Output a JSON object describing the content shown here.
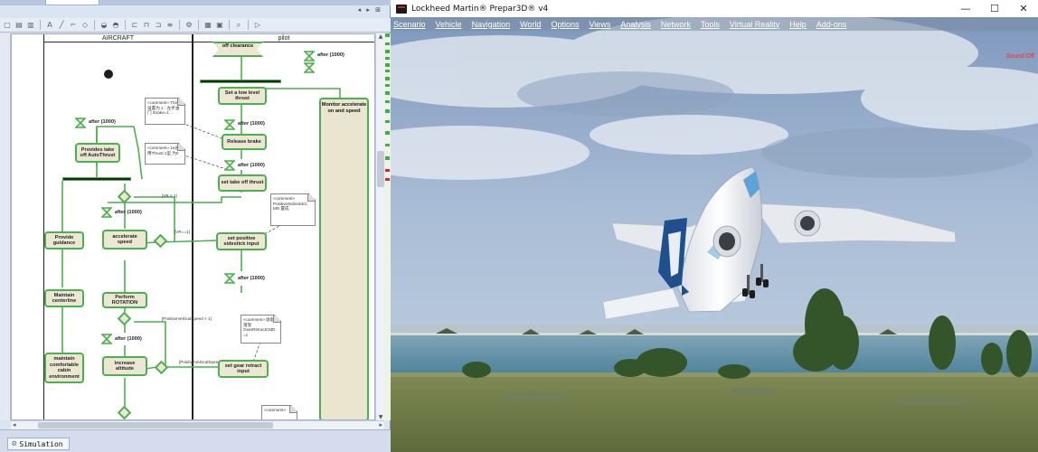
{
  "modeler": {
    "nav_arrows": "◂ ▸ ⊞",
    "status_tab": {
      "label": "Simulation"
    },
    "lanes": [
      "AIRCRAFT",
      "pilot"
    ],
    "initial_node": true,
    "actions": {
      "provide_takeoff_autothrust": "Provides take off AutoThrust",
      "provide_guidance": "Provide guidance",
      "maintain_centerline": "Maintain centerline",
      "maintain_cabin": "maintain comfortable cabin environment",
      "accelerate_speed": "accelerate speed",
      "perform_rotation": "Perform ROTATION",
      "increase_altitude": "increase altitude",
      "off_clearance": "off clearance",
      "set_low_level_thrust": "Set a low level thrust",
      "release_brake": "Release brake",
      "set_takeoff_thrust": "set take off thrust",
      "set_positive_sidestick": "set positive sidestick input",
      "set_gear_retract": "set gear retract input",
      "monitor_speed": "Monitor accelerate on and speed"
    },
    "timers": {
      "t1": "after (1000)",
      "t2": "after (1000)",
      "t3": "after (1000)",
      "t4": "after (1000)",
      "t5": "after (1000)",
      "t6": "after (1000)",
      "t7": "after (1000)"
    },
    "guards": {
      "vr_lt": "[VR < 1]",
      "vr_eq": "[VR==1]",
      "pos_vs_lt": "[PositiveVerticalSpeed < 1]",
      "pos_vs_eq": "[PositiveVerticalSpeed == 1]"
    },
    "notes": {
      "n1": "«comment» Thrust 设置为 1 : 左手油门 Ibrake=1",
      "n2": "«comment» 1e总,用Thrust 1型 为0",
      "n3": "«comment» PositiveSidestickC MD 置成",
      "n4": "«comment» 收起落架 GearRetractCMD =1",
      "n5": "«comment»"
    }
  },
  "simulator": {
    "window_title": "Lockheed Martin® Prepar3D® v4",
    "window_controls": {
      "minimize": "—",
      "maximize": "☐",
      "close": "✕"
    },
    "menu": [
      "Scenario",
      "Vehicle",
      "Navigation",
      "World",
      "Options",
      "Views",
      "Analysis",
      "Network",
      "Tools",
      "Virtual Reality",
      "Help",
      "Add-ons"
    ],
    "sound_status": "Sound Off",
    "colors": {
      "sky_top": "#9ab0cd",
      "sea": "#5d8fa6",
      "grass": "#6f7c48",
      "status_red": "#ff2a2a",
      "activity_border": "#4caf50"
    }
  }
}
